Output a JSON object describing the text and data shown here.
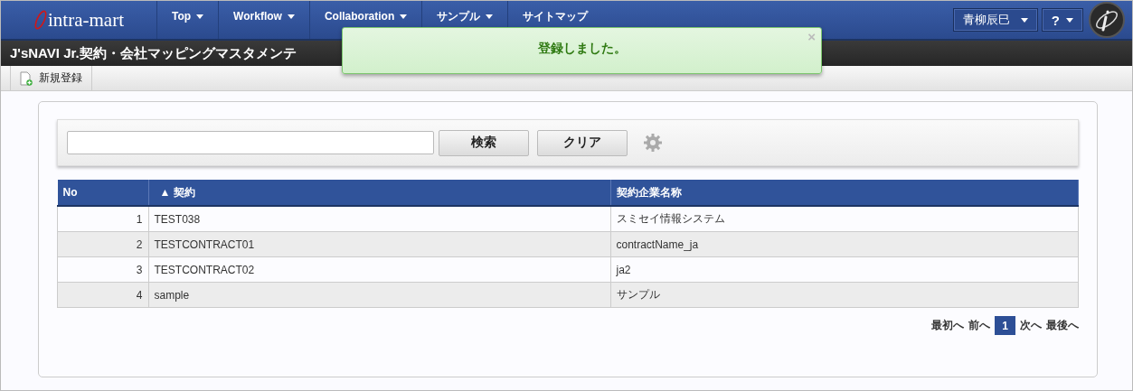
{
  "header": {
    "logo": "intra-mart",
    "nav": [
      {
        "label": "Top",
        "dropdown": true
      },
      {
        "label": "Workflow",
        "dropdown": true
      },
      {
        "label": "Collaboration",
        "dropdown": true
      },
      {
        "label": "サンプル",
        "dropdown": true
      },
      {
        "label": "サイトマップ",
        "dropdown": false
      }
    ],
    "user": "青柳辰巳",
    "help": "?"
  },
  "page_title": "J'sNAVI Jr.契約・会社マッピングマスタメンテ",
  "toast": {
    "message": "登録しました。",
    "close": "×"
  },
  "toolbar": {
    "new_button": "新規登録"
  },
  "search": {
    "search_button": "検索",
    "clear_button": "クリア"
  },
  "table": {
    "columns": [
      {
        "label": "No",
        "sorted": false
      },
      {
        "label": "契約",
        "sorted": true,
        "sort_mark": "▲"
      },
      {
        "label": "契約企業名称",
        "sorted": false
      }
    ],
    "rows": [
      [
        "1",
        "TEST038",
        "スミセイ情報システム"
      ],
      [
        "2",
        "TESTCONTRACT01",
        "contractName_ja"
      ],
      [
        "3",
        "TESTCONTRACT02",
        "ja2"
      ],
      [
        "4",
        "sample",
        "サンプル"
      ]
    ]
  },
  "pagination": {
    "first": "最初へ",
    "prev": "前へ",
    "pages": [
      {
        "label": "1",
        "selected": true
      }
    ],
    "next": "次へ",
    "last": "最後へ"
  }
}
